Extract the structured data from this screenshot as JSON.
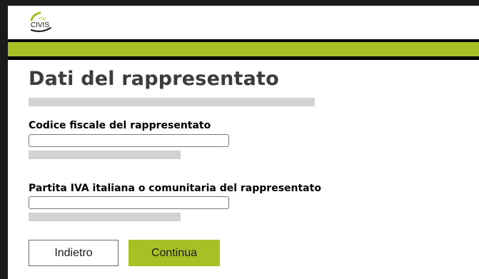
{
  "header": {
    "logo_small_text": "my",
    "logo_text": "CIVIS"
  },
  "page": {
    "title": "Dati del rappresentato"
  },
  "form": {
    "fiscal_code_label": "Codice fiscale del rappresentato",
    "fiscal_code_value": "",
    "vat_label": "Partita IVA italiana o comunitaria del rappresentato",
    "vat_value": ""
  },
  "actions": {
    "back_label": "Indietro",
    "continue_label": "Continua"
  },
  "colors": {
    "brand_green": "#a7c125",
    "placeholder_grey": "#d2d2d2",
    "title_text": "#3c3c3c"
  }
}
